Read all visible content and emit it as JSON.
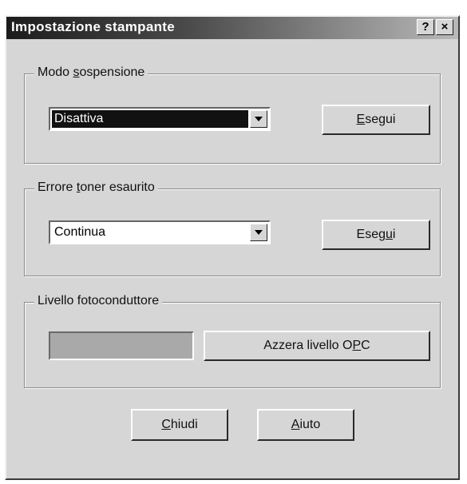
{
  "window": {
    "title": "Impostazione stampante",
    "help_button": "?",
    "close_button": "×"
  },
  "sleep_mode": {
    "legend_prefix": "Modo ",
    "legend_accel": "s",
    "legend_suffix": "ospensione",
    "selected_value": "Disattiva",
    "apply_accel": "E",
    "apply_rest": "segui"
  },
  "toner_error": {
    "legend_prefix": "Errore ",
    "legend_accel": "t",
    "legend_suffix": "oner esaurito",
    "selected_value": "Continua",
    "apply_prefix": "Eseg",
    "apply_accel": "u",
    "apply_suffix": "i"
  },
  "photoconductor": {
    "legend": "Livello fotoconduttore",
    "level_percent": 100,
    "reset_prefix": "Azzera livello O",
    "reset_accel": "P",
    "reset_suffix": "C"
  },
  "footer": {
    "close_accel": "C",
    "close_rest": "hiudi",
    "help_accel": "A",
    "help_rest": "iuto"
  }
}
